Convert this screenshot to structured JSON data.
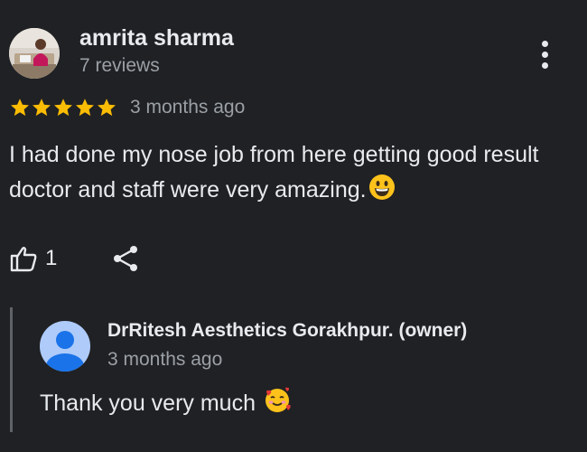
{
  "review": {
    "author_name": "amrita sharma",
    "review_count": "7 reviews",
    "rating": 5,
    "max_rating": 5,
    "date": "3 months ago",
    "text": "I had done my nose job from here getting good result doctor and staff were very amazing.",
    "text_emoji": "grinning-face-emoji",
    "like_count": "1"
  },
  "owner_reply": {
    "name": "DrRitesh Aesthetics Gorakhpur. (owner)",
    "date": "3 months ago",
    "text": "Thank you very much",
    "text_emoji": "smiling-face-with-hearts-emoji"
  },
  "icons": {
    "more": "more-vert-icon",
    "like": "thumbs-up-icon",
    "share": "share-icon",
    "owner_avatar": "default-person-avatar"
  },
  "colors": {
    "background": "#202124",
    "text_primary": "#e8eaed",
    "text_secondary": "#9aa0a6",
    "star": "#fbbc04",
    "owner_avatar_bg": "#aecbfa",
    "owner_avatar_fg": "#1a73e8",
    "reply_border": "#5f6368"
  }
}
